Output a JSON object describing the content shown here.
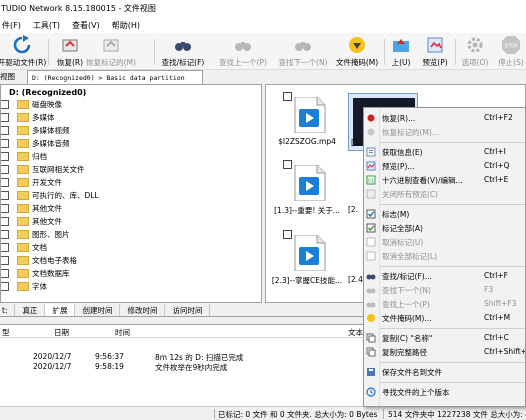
{
  "window": {
    "title": "TUDIO Network 8.15.180015 - 文件视图"
  },
  "menu": [
    "件(F)",
    "工具(T)",
    "查看(V)",
    "帮助(H)"
  ],
  "toolbar": {
    "buttons": [
      {
        "id": "open",
        "label": "开驱动文件(R)"
      },
      {
        "id": "recover",
        "label": "恢复(R)"
      },
      {
        "id": "recover_marked",
        "label": "恢复标记的(M)"
      },
      {
        "id": "find",
        "label": "查找/标记(F)"
      },
      {
        "id": "find_prev",
        "label": "查找上一个(P)"
      },
      {
        "id": "find_next",
        "label": "查找下一个(N)"
      },
      {
        "id": "file_mask",
        "label": "文件掩码(M)"
      },
      {
        "id": "up",
        "label": "上(U)"
      },
      {
        "id": "preview",
        "label": "预览(P)"
      },
      {
        "id": "options",
        "label": "选项(O)"
      },
      {
        "id": "stop",
        "label": "停止(S)"
      }
    ]
  },
  "path": {
    "left_tab": "视图",
    "value": "D: (Recognized0) > Basic data partition"
  },
  "tree": {
    "root": "D: (Recognized0)",
    "items": [
      "磁盘映像",
      "多媒体",
      "多媒体视频",
      "多媒体音频",
      "归档",
      "互联网相关文件",
      "开发文件",
      "可执行的、库、DLL",
      "其他文件",
      "其他文件",
      "图形、图片",
      "文档",
      "文档电子表格",
      "文档数据库",
      "字体"
    ]
  },
  "files": [
    {
      "name": "$I2ZSZOG.mp4"
    },
    {
      "name": "[1.3]--重要! 关于..."
    },
    {
      "name": "[2.3]--掌握CE技能..."
    }
  ],
  "files_partial": [
    "[1.",
    "[2.",
    "[2.4"
  ],
  "info_tabs": [
    "真正",
    "扩展",
    "创建时间",
    "修改时间",
    "访问时间"
  ],
  "info_tab_left": "t:",
  "log": {
    "headers": [
      "型",
      "日期",
      "时间",
      "文本"
    ],
    "rows": [
      {
        "date": "2020/12/7",
        "time": "9:56:37",
        "text": "8m 12s 的 D: 扫描已完成"
      },
      {
        "date": "2020/12/7",
        "time": "9:58:19",
        "text": "文件枚举在9秒内完成"
      }
    ]
  },
  "status": {
    "marked": "已标记: 0 文件 和 0 文件夹. 总大小为: 0 Bytes",
    "total": "514 文件夹中 1227238 文件 总大小为: 451.9"
  },
  "context_menu": {
    "items": [
      {
        "label": "恢复(R)...",
        "shortcut": "Ctrl+F2"
      },
      {
        "label": "恢复标记的(M)...",
        "shortcut": ""
      },
      {
        "label": "获取信息(E)",
        "shortcut": "Ctrl+I"
      },
      {
        "label": "预览(P)...",
        "shortcut": "Ctrl+Q"
      },
      {
        "label": "十六进制查看(V)/编辑...",
        "shortcut": "Ctrl+E"
      },
      {
        "label": "关闭所有预览(C)",
        "shortcut": ""
      },
      {
        "label": "标志(M)",
        "shortcut": ""
      },
      {
        "label": "标记全部(A)",
        "shortcut": ""
      },
      {
        "label": "取消标记(U)",
        "shortcut": ""
      },
      {
        "label": "取消全部标记(L)",
        "shortcut": ""
      },
      {
        "label": "查找/标记(F)...",
        "shortcut": "Ctrl+F"
      },
      {
        "label": "查找下一个(N)",
        "shortcut": "F3"
      },
      {
        "label": "查找上一个(P)",
        "shortcut": "Shift+F3"
      },
      {
        "label": "文件掩码(M)...",
        "shortcut": "Ctrl+M"
      },
      {
        "label": "复制(C) \"名称\"",
        "shortcut": "Ctrl+C"
      },
      {
        "label": "复制完整路径",
        "shortcut": "Ctrl+Shift+C"
      },
      {
        "label": "保存文件名到文件",
        "shortcut": ""
      },
      {
        "label": "寻找文件的上个版本",
        "shortcut": ""
      }
    ]
  },
  "colors": {
    "accent": "#0078d7",
    "folder": "#f3cd5a",
    "selection": "#dbe8f6"
  }
}
